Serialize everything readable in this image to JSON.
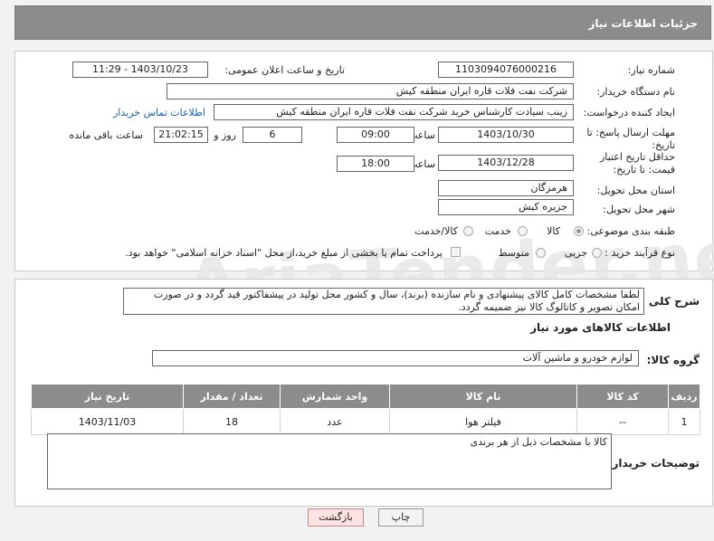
{
  "page": {
    "header_title": "جزئیات اطلاعات نیاز",
    "watermark": "AriaTender.net"
  },
  "fields": {
    "need_number_label": "شماره نیاز:",
    "need_number": "1103094076000216",
    "announce_label": "تاریخ و ساعت اعلان عمومی:",
    "announce_value": "1403/10/23 - 11:29",
    "buyer_label": "نام دستگاه خریدار:",
    "buyer_value": "شرکت نفت فلات قاره ایران منطقه کیش",
    "creator_label": "ایجاد کننده درخواست:",
    "creator_value": "زینب سیادت کارشناس خرید  شرکت نفت فلات قاره ایران منطقه کیش",
    "contact_link": "اطلاعات تماس خریدار",
    "deadline_label": "مهلت ارسال پاسخ: تا تاریخ:",
    "deadline_date": "1403/10/30",
    "time_label": "ساعت",
    "deadline_time": "09:00",
    "days_value": "6",
    "days_label": "روز و",
    "remaining_value": "21:02:15",
    "remaining_label": "ساعت باقی مانده",
    "validity_label": "حداقل تاریخ اعتبار قیمت: تا تاریخ:",
    "validity_date": "1403/12/28",
    "validity_time": "18:00",
    "province_label": "استان محل تحویل:",
    "province_value": "هرمزگان",
    "city_label": "شهر محل تحویل:",
    "city_value": "جزیره کیش",
    "category_label": "طبقه بندی موضوعی:",
    "category_options": [
      "کالا",
      "خدمت",
      "کالا/خدمت"
    ],
    "category_selected": "کالا",
    "process_label": "نوع فرآیند خرید :",
    "process_options": [
      "جزیی",
      "متوسط"
    ],
    "payment_note": "پرداخت تمام یا بخشی از مبلغ خرید،از محل \"اسناد خزانه اسلامی\" خواهد بود."
  },
  "description": {
    "label": "شرح کلی نیاز:",
    "text": "لطفا مشخصات کامل کالای پیشنهادی و نام سازنده (برند)، سال و کشور محل تولید در پیشفاکتور قید گردد و در صورت امکان تصویر و کاتالوگ کالا نیز ضمیمه گردد."
  },
  "goods": {
    "section_title": "اطلاعات کالاهای مورد نیاز",
    "group_label": "گروه کالا:",
    "group_value": "لوازم خودرو و ماشین آلات",
    "columns": [
      "ردیف",
      "کد کالا",
      "نام کالا",
      "واحد شمارش",
      "تعداد / مقدار",
      "تاریخ نیاز"
    ],
    "rows": [
      [
        "1",
        "--",
        "فیلتر هوا",
        "عدد",
        "18",
        "1403/11/03"
      ]
    ]
  },
  "buyer_notes": {
    "label": "توضیحات خریدار:",
    "text": "کالا با مشخصات ذیل از هر برندی"
  },
  "buttons": {
    "print": "چاپ",
    "back": "بازگشت"
  }
}
